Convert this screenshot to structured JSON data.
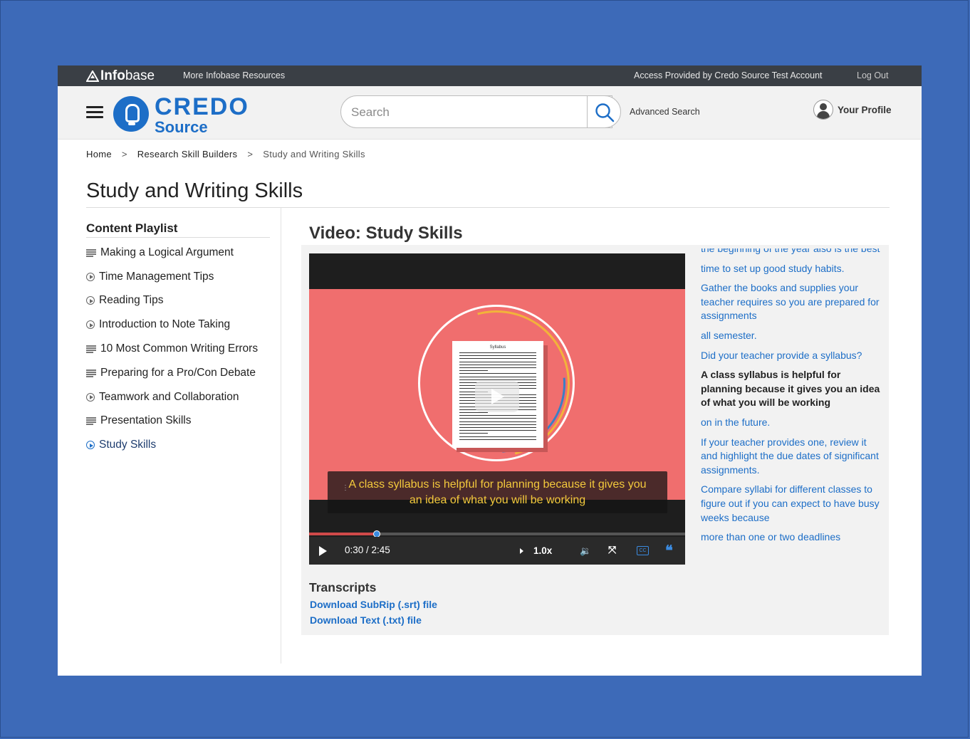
{
  "topbar": {
    "logo_bold": "Info",
    "logo_light": "base",
    "more_resources": "More Infobase Resources",
    "access": "Access Provided by Credo Source Test Account",
    "logout": "Log Out"
  },
  "header": {
    "brand_top": "CREDO",
    "brand_bottom": "Source",
    "search_placeholder": "Search",
    "advanced_search": "Advanced Search",
    "profile": "Your Profile"
  },
  "breadcrumb": {
    "home": "Home",
    "section": "Research Skill Builders",
    "current": "Study and Writing Skills",
    "separator": ">"
  },
  "page_title": "Study and Writing Skills",
  "sidebar": {
    "title": "Content Playlist",
    "items": [
      {
        "label": "Making a Logical Argument",
        "icon": "article-lines-icon"
      },
      {
        "label": "Time Management Tips",
        "icon": "play-circle-icon"
      },
      {
        "label": "Reading Tips",
        "icon": "play-circle-icon"
      },
      {
        "label": "Introduction to Note Taking",
        "icon": "play-circle-icon"
      },
      {
        "label": "10 Most Common Writing Errors",
        "icon": "article-lines-icon"
      },
      {
        "label": "Preparing for a Pro/Con Debate",
        "icon": "article-lines-icon"
      },
      {
        "label": "Teamwork and Collaboration",
        "icon": "play-circle-icon"
      },
      {
        "label": "Presentation Skills",
        "icon": "article-lines-icon"
      },
      {
        "label": "Study Skills",
        "icon": "play-circle-icon",
        "active": true
      }
    ]
  },
  "video": {
    "title": "Video: Study Skills",
    "doc_title": "Syllabus",
    "caption_line1": "A class syllabus is helpful for planning because it gives you",
    "caption_line2": "an idea of what you will be working",
    "time": "0:30 / 2:45",
    "progress": 0.18,
    "rate": "1.0x",
    "cc_label": "CC",
    "transcript_icon": "❝"
  },
  "transcript_lines": [
    "the beginning of the year also is the best",
    "time to set up good study habits.",
    "Gather the books and supplies your teacher requires so you are prepared for assignments",
    "all semester.",
    "Did your teacher provide a syllabus?",
    "A class syllabus is helpful for planning because it gives you an idea of what you will be working",
    "on in the future.",
    "If your teacher provides one, review it and highlight the due dates of significant assignments.",
    "Compare syllabi for different classes to figure out if you can expect to have busy weeks because",
    "more than one or two deadlines"
  ],
  "transcript_current_index": 5,
  "transcripts": {
    "title": "Transcripts",
    "srt": "Download SubRip (.srt) file",
    "txt": "Download Text (.txt) file"
  },
  "colors": {
    "background": "#3d6ab8",
    "brand_blue": "#1d6ec7",
    "video_stage": "#f06e6e",
    "caption_text": "#f3c93c"
  }
}
